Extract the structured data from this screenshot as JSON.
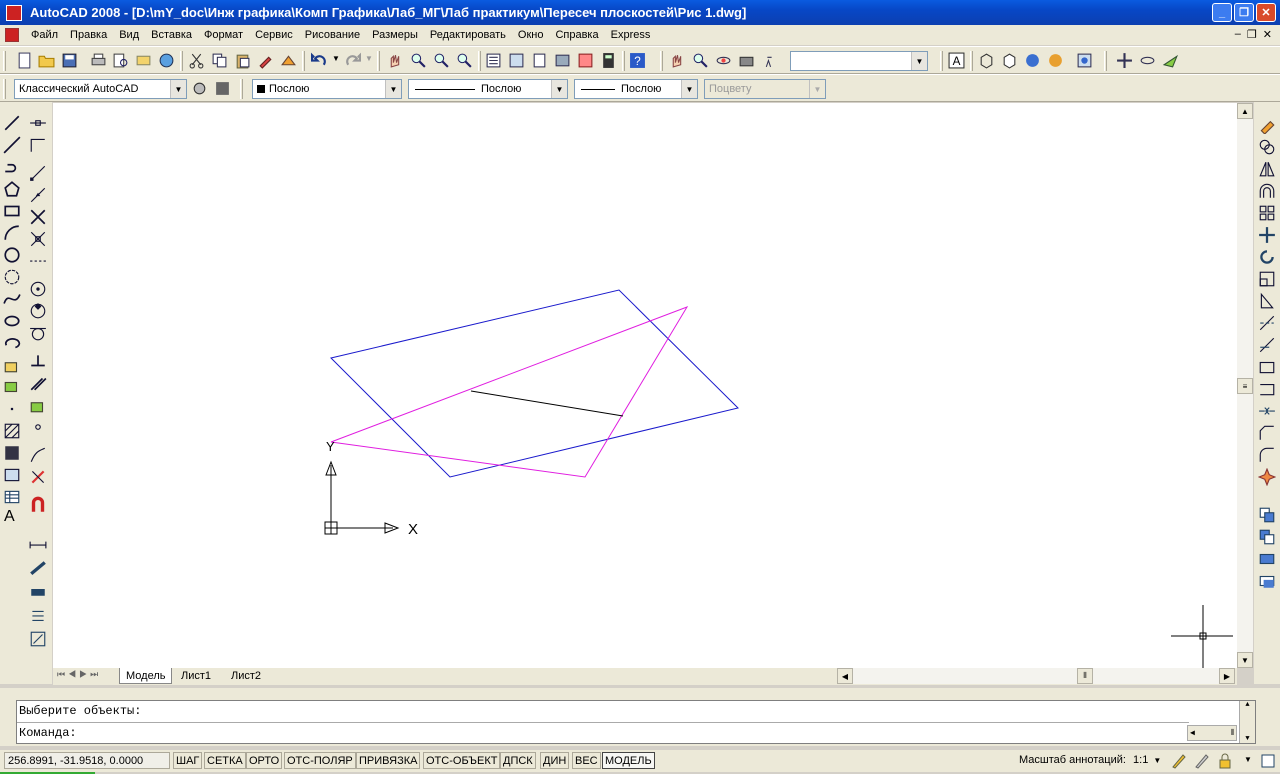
{
  "window": {
    "title": "AutoCAD 2008 - [D:\\mY_doc\\Инж графика\\Комп Графика\\Лаб_МГ\\Лаб практикум\\Пересеч плоскостей\\Рис 1.dwg]"
  },
  "menubar": {
    "items": [
      "Файл",
      "Правка",
      "Вид",
      "Вставка",
      "Формат",
      "Сервис",
      "Рисование",
      "Размеры",
      "Редактировать",
      "Окно",
      "Справка",
      "Express"
    ]
  },
  "properties_toolbar": {
    "workspace": "Классический AutoCAD",
    "layer": "Послою",
    "linetype": "Послою",
    "lineweight": "Послою",
    "plotstyle": "Поцвету"
  },
  "canvas": {
    "ucs_x_label": "X",
    "ucs_y_label": "Y",
    "colors": {
      "plane_1": "#1a1acc",
      "plane_2": "#e01ee0",
      "intersection": "#000000"
    }
  },
  "layout_tabs": [
    "Модель",
    "Лист1",
    "Лист2"
  ],
  "command": {
    "history": "Выберите объекты:",
    "prompt": "Команда:"
  },
  "status": {
    "coordinates": "256.8991, -31.9518, 0.0000",
    "toggles": [
      "ШАГ",
      "СЕТКА",
      "ОРТО",
      "ОТС-ПОЛЯР",
      "ПРИВЯЗКА",
      "ОТС-ОБЪЕКТ",
      "ДПСК",
      "ДИН",
      "ВЕС",
      "МОДЕЛЬ"
    ],
    "annotation_scale_label": "Масштаб аннотаций:",
    "annotation_scale_value": "1:1"
  }
}
